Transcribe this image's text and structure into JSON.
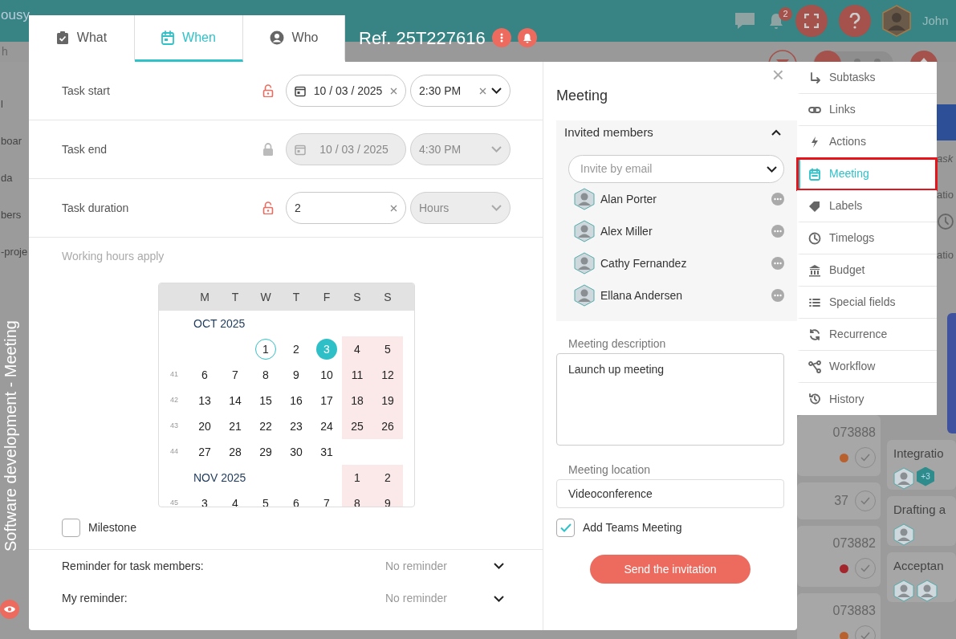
{
  "app_header": {
    "logo": "ousy",
    "notification_count": "2",
    "user_name": "John"
  },
  "sidebar": {
    "search_fragment": "h",
    "items": [
      "l",
      "boar",
      "da",
      "bers",
      "-proje"
    ]
  },
  "overlay_label": "Software development  -  Meeting",
  "tasks": [
    {
      "number": "073888",
      "color": "#b8612e"
    },
    {
      "number": "37"
    },
    {
      "number": "073882",
      "color": "#a3262c"
    },
    {
      "number": "073883",
      "color": "#b8612e"
    }
  ],
  "edge_fragments": [
    "ask",
    "atio",
    "atio"
  ],
  "board_cards": [
    {
      "title": "Integratio",
      "avatars": [
        {
          "kind": "photo"
        },
        {
          "kind": "count",
          "label": "+3"
        }
      ]
    },
    {
      "title": "Drafting a",
      "avatars": [
        {
          "kind": "photo"
        }
      ]
    },
    {
      "title": "Acceptan",
      "avatars": [
        {
          "kind": "photo"
        },
        {
          "kind": "photo"
        }
      ]
    }
  ],
  "task_modal": {
    "tabs": [
      {
        "label": "What",
        "selected": false
      },
      {
        "label": "When",
        "selected": true
      },
      {
        "label": "Who",
        "selected": false
      }
    ],
    "reference": "Ref. 25T227616",
    "schedule": [
      {
        "label": "Task start",
        "locked": false,
        "fields": [
          {
            "kind": "date",
            "value": "10 / 03 / 2025",
            "disabled": false
          },
          {
            "kind": "time",
            "value": "2:30 PM",
            "disabled": false
          }
        ]
      },
      {
        "label": "Task end",
        "locked": true,
        "fields": [
          {
            "kind": "date",
            "value": "10 / 03 / 2025",
            "disabled": true
          },
          {
            "kind": "time",
            "value": "4:30 PM",
            "disabled": true
          }
        ]
      },
      {
        "label": "Task duration",
        "locked": false,
        "fields": [
          {
            "kind": "number",
            "value": "2",
            "disabled": false
          },
          {
            "kind": "select",
            "value": "Hours",
            "disabled": true
          }
        ]
      }
    ],
    "working_hours_note": "Working hours apply",
    "calendar": {
      "weekdays": [
        "M",
        "T",
        "W",
        "T",
        "F",
        "S",
        "S"
      ],
      "months": [
        {
          "label": "OCT 2025",
          "label_inline": false,
          "weeks": [
            {
              "end_aligned": true,
              "days": [
                {
                  "day": "1",
                  "selected": false,
                  "today": true
                },
                {
                  "day": "2",
                  "selected": false,
                  "today": false
                },
                {
                  "day": "3",
                  "selected": true,
                  "today": false
                },
                {
                  "day": "4",
                  "selected": false,
                  "today": false
                },
                {
                  "day": "5",
                  "selected": false,
                  "today": false
                }
              ]
            },
            {
              "number": "41",
              "days": [
                {
                  "day": "6",
                  "selected": false,
                  "today": false
                },
                {
                  "day": "7",
                  "selected": false,
                  "today": false
                },
                {
                  "day": "8",
                  "selected": false,
                  "today": false
                },
                {
                  "day": "9",
                  "selected": false,
                  "today": false
                },
                {
                  "day": "10",
                  "selected": false,
                  "today": false
                },
                {
                  "day": "11",
                  "selected": false,
                  "today": false
                },
                {
                  "day": "12",
                  "selected": false,
                  "today": false
                }
              ]
            },
            {
              "number": "42",
              "days": [
                {
                  "day": "13",
                  "selected": false,
                  "today": false
                },
                {
                  "day": "14",
                  "selected": false,
                  "today": false
                },
                {
                  "day": "15",
                  "selected": false,
                  "today": false
                },
                {
                  "day": "16",
                  "selected": false,
                  "today": false
                },
                {
                  "day": "17",
                  "selected": false,
                  "today": false
                },
                {
                  "day": "18",
                  "selected": false,
                  "today": false
                },
                {
                  "day": "19",
                  "selected": false,
                  "today": false
                }
              ]
            },
            {
              "number": "43",
              "days": [
                {
                  "day": "20",
                  "selected": false,
                  "today": false
                },
                {
                  "day": "21",
                  "selected": false,
                  "today": false
                },
                {
                  "day": "22",
                  "selected": false,
                  "today": false
                },
                {
                  "day": "23",
                  "selected": false,
                  "today": false
                },
                {
                  "day": "24",
                  "selected": false,
                  "today": false
                },
                {
                  "day": "25",
                  "selected": false,
                  "today": false
                },
                {
                  "day": "26",
                  "selected": false,
                  "today": false
                }
              ]
            },
            {
              "number": "44",
              "days": [
                {
                  "day": "27",
                  "selected": false,
                  "today": false
                },
                {
                  "day": "28",
                  "selected": false,
                  "today": false
                },
                {
                  "day": "29",
                  "selected": false,
                  "today": false
                },
                {
                  "day": "30",
                  "selected": false,
                  "today": false
                },
                {
                  "day": "31",
                  "selected": false,
                  "today": false
                }
              ]
            }
          ]
        },
        {
          "label": "NOV 2025",
          "label_inline": true,
          "weeks": [
            {
              "end_aligned": true,
              "days": [
                {
                  "day": "1",
                  "selected": false,
                  "today": false
                },
                {
                  "day": "2",
                  "selected": false,
                  "today": false
                }
              ]
            },
            {
              "number": "45",
              "days": [
                {
                  "day": "3",
                  "selected": false,
                  "today": false
                },
                {
                  "day": "4",
                  "selected": false,
                  "today": false
                },
                {
                  "day": "5",
                  "selected": false,
                  "today": false
                },
                {
                  "day": "6",
                  "selected": false,
                  "today": false
                },
                {
                  "day": "7",
                  "selected": false,
                  "today": false
                },
                {
                  "day": "8",
                  "selected": false,
                  "today": false
                },
                {
                  "day": "9",
                  "selected": false,
                  "today": false
                }
              ]
            }
          ]
        }
      ]
    },
    "milestone": {
      "label": "Milestone",
      "checked": false
    },
    "reminders": [
      {
        "label": "Reminder for task members:",
        "value": "No reminder"
      },
      {
        "label": "My reminder:",
        "value": "No reminder"
      }
    ]
  },
  "meeting": {
    "title": "Meeting",
    "close_symbol": "×",
    "members_heading": "Invited members",
    "members_expanded": true,
    "invite_placeholder": "Invite by email",
    "members": [
      {
        "name": "Alan Porter"
      },
      {
        "name": "Alex Miller"
      },
      {
        "name": "Cathy Fernandez"
      },
      {
        "name": "Ellana Andersen"
      }
    ],
    "description_label": "Meeting description",
    "description": "Launch up meeting",
    "location_label": "Meeting location",
    "location": "Videoconference",
    "teams": {
      "label": "Add Teams Meeting",
      "checked": true
    },
    "send_button": "Send the invitation"
  },
  "side_menu": [
    {
      "label": "Subtasks",
      "selected": false
    },
    {
      "label": "Links",
      "selected": false
    },
    {
      "label": "Actions",
      "selected": false
    },
    {
      "label": "Meeting",
      "selected": true
    },
    {
      "label": "Labels",
      "selected": false
    },
    {
      "label": "Timelogs",
      "selected": false
    },
    {
      "label": "Budget",
      "selected": false
    },
    {
      "label": "Special fields",
      "selected": false
    },
    {
      "label": "Recurrence",
      "selected": false
    },
    {
      "label": "Workflow",
      "selected": false
    },
    {
      "label": "History",
      "selected": false
    }
  ]
}
